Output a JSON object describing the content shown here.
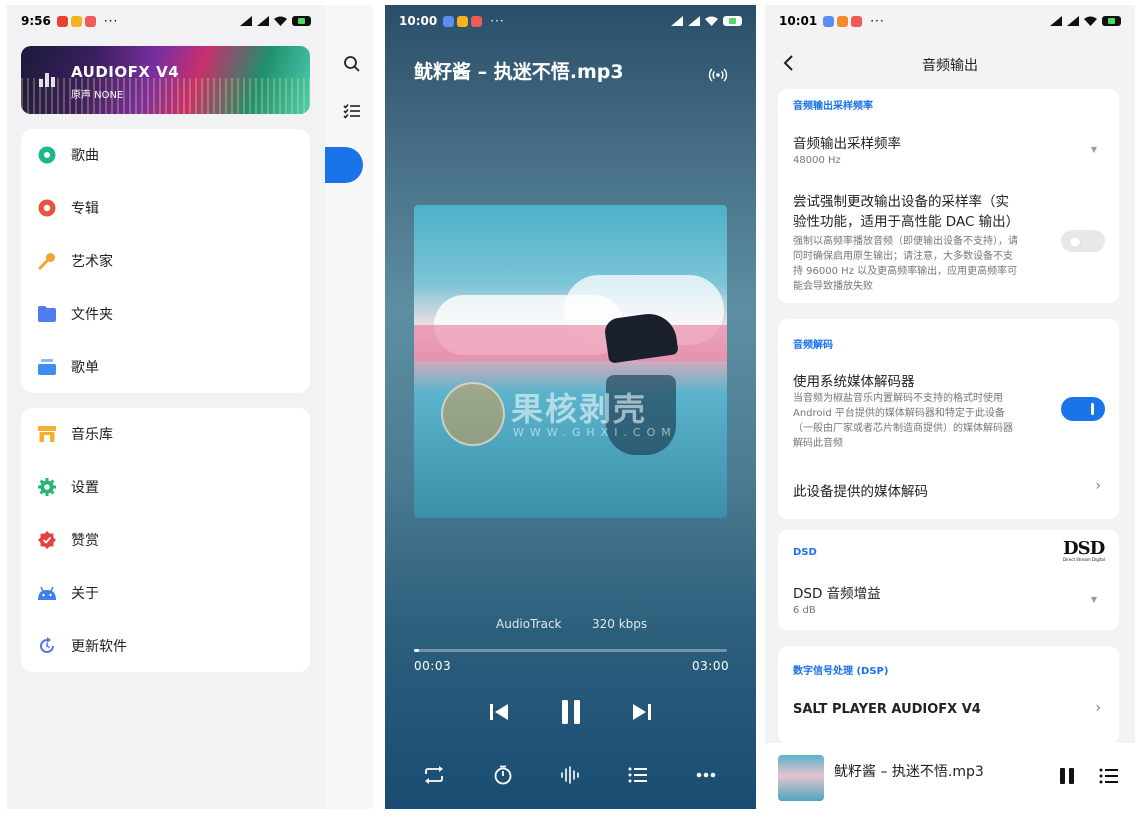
{
  "screen1": {
    "status": {
      "time": "9:56",
      "dots": "···"
    },
    "banner": {
      "title": "AUDIOFX V4",
      "subtitle": "原声 NONE"
    },
    "menu_top": [
      {
        "label": "歌曲",
        "icon": "disc-icon",
        "color": "#1bb98a"
      },
      {
        "label": "专辑",
        "icon": "album-icon",
        "color": "#e8553e"
      },
      {
        "label": "艺术家",
        "icon": "microphone-icon",
        "color": "#f2a52a"
      },
      {
        "label": "文件夹",
        "icon": "folder-icon",
        "color": "#4f7df0"
      },
      {
        "label": "歌单",
        "icon": "playlist-icon",
        "color": "#3d8cf0"
      }
    ],
    "menu_bottom": [
      {
        "label": "音乐库",
        "icon": "store-icon",
        "color": "#f4b02a"
      },
      {
        "label": "设置",
        "icon": "gear-icon",
        "color": "#22b573"
      },
      {
        "label": "赞赏",
        "icon": "badge-icon",
        "color": "#e84040"
      },
      {
        "label": "关于",
        "icon": "android-icon",
        "color": "#3d7ff0"
      },
      {
        "label": "更新软件",
        "icon": "refresh-icon",
        "color": "#5b74ee"
      }
    ]
  },
  "screen2": {
    "status": {
      "time": "10:00",
      "dots": "···"
    },
    "song_title": "鱿籽酱 – 执迷不悟.mp3",
    "output": "AudioTrack",
    "bitrate": "320 kbps",
    "position": "00:03",
    "duration": "03:00",
    "progress": 0.017,
    "watermark": {
      "main": "果核剥壳",
      "sub": "WWW.GHXI.COM"
    }
  },
  "screen3": {
    "status": {
      "time": "10:01",
      "dots": "···"
    },
    "header_title": "音频输出",
    "section_sample_rate": "音频输出采样频率",
    "sample_rate_title": "音频输出采样频率",
    "sample_rate_value": "48000 Hz",
    "force_rate_title_1": "尝试强制更改输出设备的采样率（实",
    "force_rate_title_2": "验性功能，适用于高性能 DAC 输出）",
    "force_rate_desc_1": "强制以高频率播放音频（即便输出设备不支持），请",
    "force_rate_desc_2": "同时确保启用原生输出；请注意，大多数设备不支",
    "force_rate_desc_3": "持 96000 Hz 以及更高频率输出，应用更高频率可",
    "force_rate_desc_4": "能会导致播放失败",
    "force_rate_enabled": false,
    "section_decoder": "音频解码",
    "system_decoder_title": "使用系统媒体解码器",
    "system_decoder_desc_1": "当音频为椒盐音乐内置解码不支持的格式时使用",
    "system_decoder_desc_2": "Android 平台提供的媒体解码器和特定于此设备",
    "system_decoder_desc_3": "（一般由厂家或者芯片制造商提供）的媒体解码器",
    "system_decoder_desc_4": "解码此音频",
    "system_decoder_enabled": true,
    "device_decoders": "此设备提供的媒体解码",
    "section_dsd": "DSD",
    "dsd_logo": "DSD",
    "dsd_logo_sub": "Direct Stream Digital",
    "dsd_gain_title": "DSD 音频增益",
    "dsd_gain_value": "6 dB",
    "section_dsp": "数字信号处理 (DSP)",
    "dsp_item": "SALT PLAYER AUDIOFX V4",
    "mini_title": "鱿籽酱 – 执迷不悟.mp3"
  }
}
